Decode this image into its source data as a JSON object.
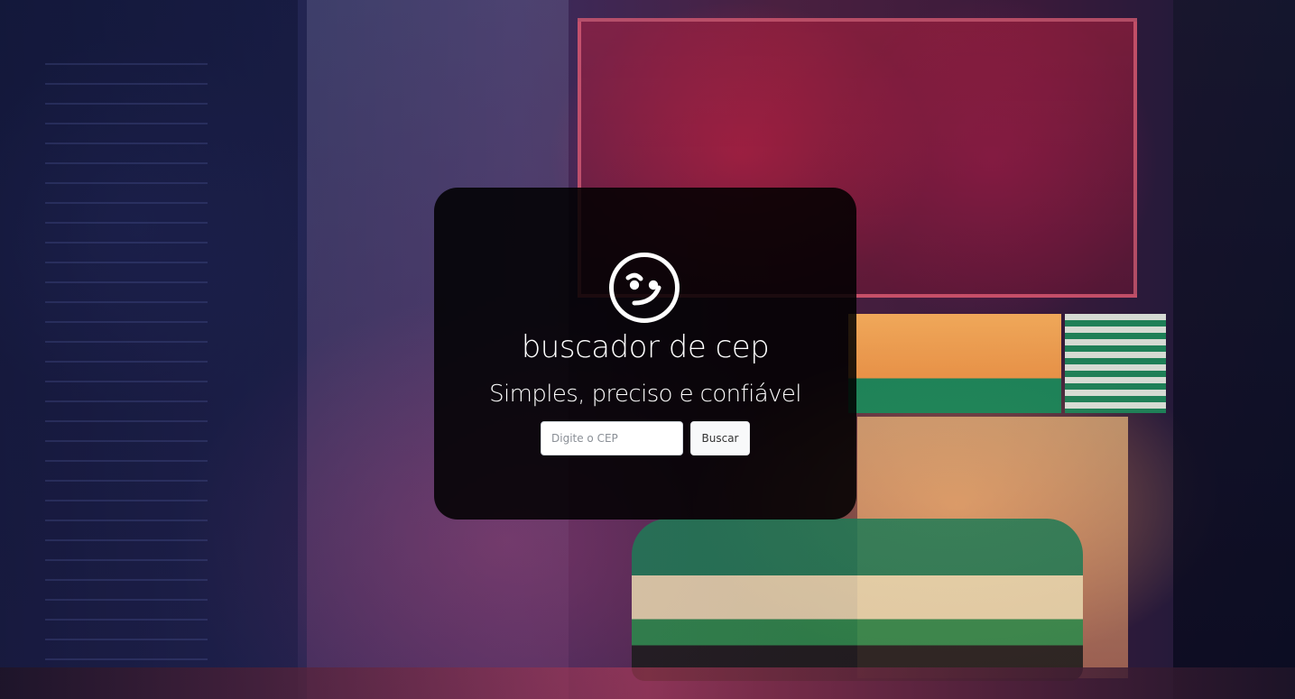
{
  "hero": {
    "logo_icon": "smiley-face-icon",
    "title": "buscador de cep",
    "subtitle": "Simples, preciso e confiável"
  },
  "search": {
    "placeholder": "Digite o CEP",
    "value": "",
    "button_label": "Buscar"
  },
  "colors": {
    "card_background": "#000000",
    "text": "#ffffff",
    "button_background": "#f8f9fa"
  }
}
